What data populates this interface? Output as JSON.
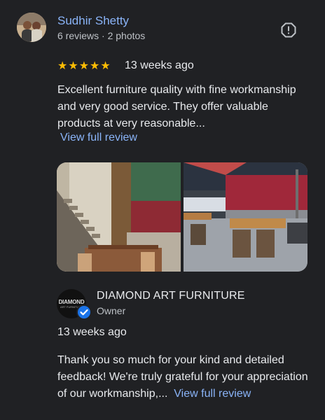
{
  "review": {
    "reviewer_name": "Sudhir Shetty",
    "reviewer_meta": "6 reviews · 2 photos",
    "stars": "★★★★★",
    "rating": 5,
    "time": "13 weeks ago",
    "text": "Excellent furniture quality with fine workmanship and very good service. They offer valuable products at very reasonable...",
    "view_full": "View full review"
  },
  "photos": [
    {
      "name": "staircase-dining-photo"
    },
    {
      "name": "terrace-dining-photo"
    }
  ],
  "owner": {
    "logo_text": "DIAMOND",
    "logo_sub": "ART FURNITURE",
    "name": "DIAMOND ART FURNITURE",
    "label": "Owner",
    "time": "13 weeks ago",
    "reply_text": "Thank you so much for your kind and detailed feedback! We're truly grateful for your appreciation of our workmanship,...",
    "view_full": "View full review"
  },
  "colors": {
    "background": "#202124",
    "link": "#8ab4f8",
    "star": "#fbbc04",
    "verified": "#1a73e8"
  },
  "icons": [
    "report-icon",
    "verified-check-icon"
  ]
}
